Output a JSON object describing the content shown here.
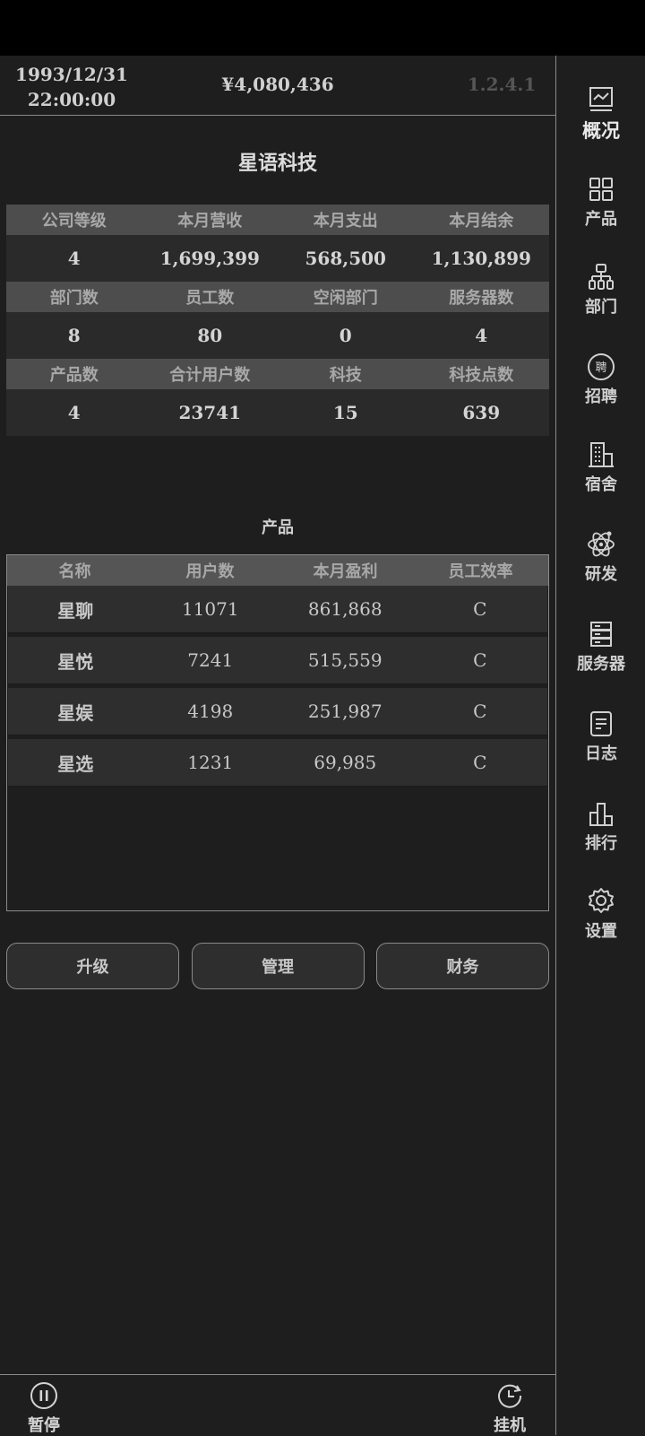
{
  "header": {
    "date": "1993/12/31",
    "time": "22:00:00",
    "money": "¥4,080,436",
    "version": "1.2.4.1"
  },
  "company_name": "星语科技",
  "stats": [
    {
      "labels": [
        "公司等级",
        "本月营收",
        "本月支出",
        "本月结余"
      ],
      "values": [
        "4",
        "1,699,399",
        "568,500",
        "1,130,899"
      ]
    },
    {
      "labels": [
        "部门数",
        "员工数",
        "空闲部门",
        "服务器数"
      ],
      "values": [
        "8",
        "80",
        "0",
        "4"
      ]
    },
    {
      "labels": [
        "产品数",
        "合计用户数",
        "科技",
        "科技点数"
      ],
      "values": [
        "4",
        "23741",
        "15",
        "639"
      ]
    }
  ],
  "products_title": "产品",
  "products": {
    "headers": [
      "名称",
      "用户数",
      "本月盈利",
      "员工效率"
    ],
    "rows": [
      [
        "星聊",
        "11071",
        "861,868",
        "C"
      ],
      [
        "星悦",
        "7241",
        "515,559",
        "C"
      ],
      [
        "星娱",
        "4198",
        "251,987",
        "C"
      ],
      [
        "星选",
        "1231",
        "69,985",
        "C"
      ]
    ]
  },
  "buttons": {
    "upgrade": "升级",
    "manage": "管理",
    "finance": "财务"
  },
  "bottom": {
    "pause": "暂停",
    "idle": "挂机"
  },
  "sidebar": [
    {
      "label": "概况",
      "icon": "chart-monitor-icon",
      "active": true
    },
    {
      "label": "产品",
      "icon": "grid-icon"
    },
    {
      "label": "部门",
      "icon": "org-chart-icon"
    },
    {
      "label": "招聘",
      "icon": "hire-icon"
    },
    {
      "label": "宿舍",
      "icon": "building-icon"
    },
    {
      "label": "研发",
      "icon": "atom-icon"
    },
    {
      "label": "服务器",
      "icon": "server-icon"
    },
    {
      "label": "日志",
      "icon": "log-icon"
    },
    {
      "label": "排行",
      "icon": "ranking-icon"
    },
    {
      "label": "设置",
      "icon": "gear-icon"
    }
  ],
  "colors": {
    "background": "#1e1e1e",
    "header_row": "#4d4d4d",
    "value_row": "#2a2a2a",
    "border": "#8a8a8a",
    "version_text": "#555555"
  }
}
